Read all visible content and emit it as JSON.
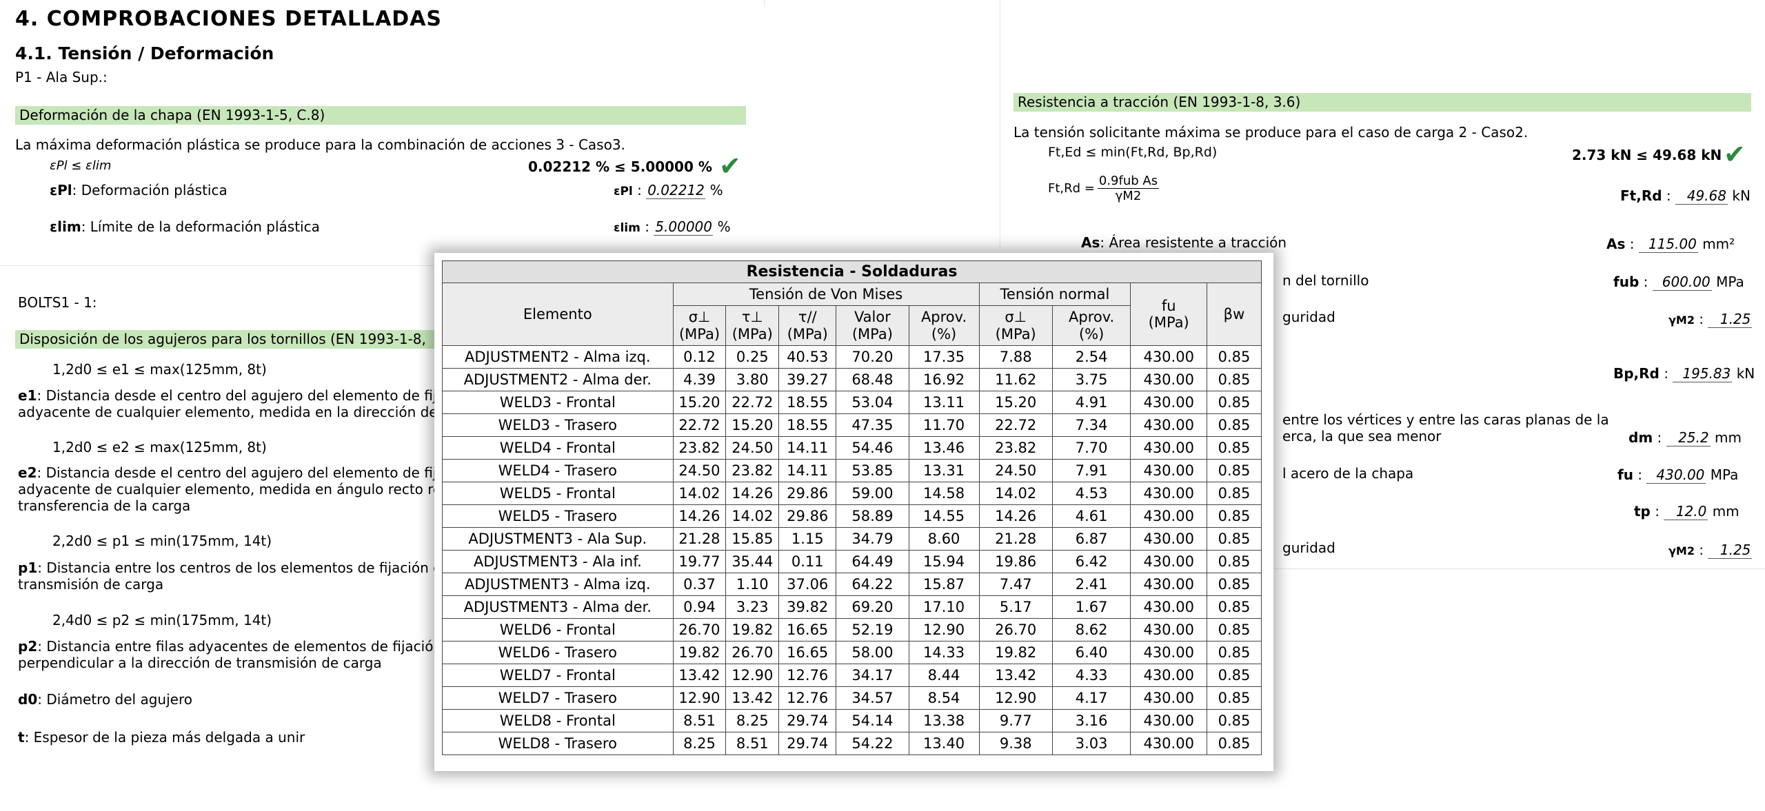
{
  "header": {
    "section": "4. COMPROBACIONES DETALLADAS",
    "subsection": "4.1. Tensión / Deformación",
    "element": "P1 - Ala Sup.:"
  },
  "deformation": {
    "bar": "Deformación de la chapa (EN 1993-1-5, C.8)",
    "intro": "La máxima deformación plástica se produce para la combinación de acciones 3 - Caso3.",
    "formula": "εPl ≤ εlim",
    "result": "0.02212 % ≤ 5.00000 %",
    "pl_symbol": "εPl",
    "pl_label": ": Deformación plástica",
    "pl_value": "0.02212",
    "pl_unit": "%",
    "lim_symbol": "εlim",
    "lim_label": ": Límite de la deformación plástica",
    "lim_value": "5.00000",
    "lim_unit": "%"
  },
  "tension": {
    "bar": "Resistencia a tracción (EN 1993-1-8, 3.6)",
    "intro": "La tensión solicitante máxima se produce para el caso de carga 2 - Caso2.",
    "formula1": "Ft,Ed ≤ min(Ft,Rd, Bp,Rd)",
    "result": "2.73 kN ≤ 49.68 kN",
    "formula2_lhs": "Ft,Rd =",
    "formula2_num": "0.9fub As",
    "formula2_den": "γM2",
    "ftrd_symbol": "Ft,Rd",
    "ftrd_value": "49.68",
    "ftrd_unit": "kN",
    "as_symbol": "As",
    "as_label": ": Área resistente a tracción",
    "as_value": "115.00",
    "as_unit": "mm²",
    "fub_label_frag": "n del tornillo",
    "fub_symbol": "fub",
    "fub_value": "600.00",
    "fub_unit": "MPa",
    "gm2_label_frag": "guridad",
    "gm2_symbol": "γM2",
    "gm2_value": "1.25",
    "bprd_symbol": "Bp,Rd",
    "bprd_value": "195.83",
    "bprd_unit": "kN",
    "dm_label_frag1": "entre los vértices y entre las caras planas de la",
    "dm_label_frag2": "erca, la que sea menor",
    "dm_symbol": "dm",
    "dm_value": "25.2",
    "dm_unit": "mm",
    "fu_label_frag": "l acero de la chapa",
    "fu_symbol": "fu",
    "fu_value": "430.00",
    "fu_unit": "MPa",
    "tp_symbol": "tp",
    "tp_value": "12.0",
    "tp_unit": "mm",
    "gm2b_label_frag": "guridad",
    "gm2b_symbol": "γM2",
    "gm2b_value": "1.25"
  },
  "bolts": {
    "element": "BOLTS1 - 1:",
    "bar": "Disposición de los agujeros para los tornillos (EN 1993-1-8,",
    "f1": "1,2d0 ≤ e1 ≤ max(125mm, 8t)",
    "e1_symbol": "e1",
    "e1_text1": ": Distancia desde el centro del agujero del elemento de fija",
    "e1_text2": "adyacente de cualquier elemento, medida en la dirección de",
    "f2": "1,2d0 ≤ e2 ≤ max(125mm, 8t)",
    "e2_symbol": "e2",
    "e2_text1": ": Distancia desde el centro del agujero del elemento de fija",
    "e2_text2": "adyacente de cualquier elemento, medida en ángulo recto re",
    "e2_text3": "transferencia de la carga",
    "f3": "2,2d0 ≤ p1 ≤ min(175mm, 14t)",
    "p1_symbol": "p1",
    "p1_text1": ": Distancia entre los centros de los elementos de fijación e",
    "p1_text2": "transmisión de carga",
    "f4": "2,4d0 ≤ p2 ≤ min(175mm, 14t)",
    "p2_symbol": "p2",
    "p2_text1": ": Distancia entre filas adyacentes de elementos de fijación,",
    "p2_text2": "perpendicular a la dirección de transmisión de carga",
    "d0_symbol": "d0",
    "d0_text": ": Diámetro del agujero",
    "t_symbol": "t",
    "t_text": ": Espesor de la pieza más delgada a unir"
  },
  "welds": {
    "title": "Resistencia - Soldaduras",
    "col_elemento": "Elemento",
    "group_vonmises": "Tensión de Von Mises",
    "group_normal": "Tensión normal",
    "h_sigma": "σ⊥",
    "h_tau": "τ⊥",
    "h_taupar": "τ//",
    "h_valor": "Valor",
    "h_aprov": "Aprov.",
    "h_sigma2": "σ⊥",
    "h_aprov2": "Aprov.",
    "h_fu": "fu",
    "h_beta": "βw",
    "u_mpa": "(MPa)",
    "u_pct": "(%)",
    "rows": [
      [
        "ADJUSTMENT2 - Alma izq.",
        "0.12",
        "0.25",
        "40.53",
        "70.20",
        "17.35",
        "7.88",
        "2.54",
        "430.00",
        "0.85"
      ],
      [
        "ADJUSTMENT2 - Alma der.",
        "4.39",
        "3.80",
        "39.27",
        "68.48",
        "16.92",
        "11.62",
        "3.75",
        "430.00",
        "0.85"
      ],
      [
        "WELD3 - Frontal",
        "15.20",
        "22.72",
        "18.55",
        "53.04",
        "13.11",
        "15.20",
        "4.91",
        "430.00",
        "0.85"
      ],
      [
        "WELD3 - Trasero",
        "22.72",
        "15.20",
        "18.55",
        "47.35",
        "11.70",
        "22.72",
        "7.34",
        "430.00",
        "0.85"
      ],
      [
        "WELD4 - Frontal",
        "23.82",
        "24.50",
        "14.11",
        "54.46",
        "13.46",
        "23.82",
        "7.70",
        "430.00",
        "0.85"
      ],
      [
        "WELD4 - Trasero",
        "24.50",
        "23.82",
        "14.11",
        "53.85",
        "13.31",
        "24.50",
        "7.91",
        "430.00",
        "0.85"
      ],
      [
        "WELD5 - Frontal",
        "14.02",
        "14.26",
        "29.86",
        "59.00",
        "14.58",
        "14.02",
        "4.53",
        "430.00",
        "0.85"
      ],
      [
        "WELD5 - Trasero",
        "14.26",
        "14.02",
        "29.86",
        "58.89",
        "14.55",
        "14.26",
        "4.61",
        "430.00",
        "0.85"
      ],
      [
        "ADJUSTMENT3 - Ala Sup.",
        "21.28",
        "15.85",
        "1.15",
        "34.79",
        "8.60",
        "21.28",
        "6.87",
        "430.00",
        "0.85"
      ],
      [
        "ADJUSTMENT3 - Ala inf.",
        "19.77",
        "35.44",
        "0.11",
        "64.49",
        "15.94",
        "19.86",
        "6.42",
        "430.00",
        "0.85"
      ],
      [
        "ADJUSTMENT3 - Alma izq.",
        "0.37",
        "1.10",
        "37.06",
        "64.22",
        "15.87",
        "7.47",
        "2.41",
        "430.00",
        "0.85"
      ],
      [
        "ADJUSTMENT3 - Alma der.",
        "0.94",
        "3.23",
        "39.82",
        "69.20",
        "17.10",
        "5.17",
        "1.67",
        "430.00",
        "0.85"
      ],
      [
        "WELD6 - Frontal",
        "26.70",
        "19.82",
        "16.65",
        "52.19",
        "12.90",
        "26.70",
        "8.62",
        "430.00",
        "0.85"
      ],
      [
        "WELD6 - Trasero",
        "19.82",
        "26.70",
        "16.65",
        "58.00",
        "14.33",
        "19.82",
        "6.40",
        "430.00",
        "0.85"
      ],
      [
        "WELD7 - Frontal",
        "13.42",
        "12.90",
        "12.76",
        "34.17",
        "8.44",
        "13.42",
        "4.33",
        "430.00",
        "0.85"
      ],
      [
        "WELD7 - Trasero",
        "12.90",
        "13.42",
        "12.76",
        "34.57",
        "8.54",
        "12.90",
        "4.17",
        "430.00",
        "0.85"
      ],
      [
        "WELD8 - Frontal",
        "8.51",
        "8.25",
        "29.74",
        "54.14",
        "13.38",
        "9.77",
        "3.16",
        "430.00",
        "0.85"
      ],
      [
        "WELD8 - Trasero",
        "8.25",
        "8.51",
        "29.74",
        "54.22",
        "13.40",
        "9.38",
        "3.03",
        "430.00",
        "0.85"
      ]
    ]
  }
}
